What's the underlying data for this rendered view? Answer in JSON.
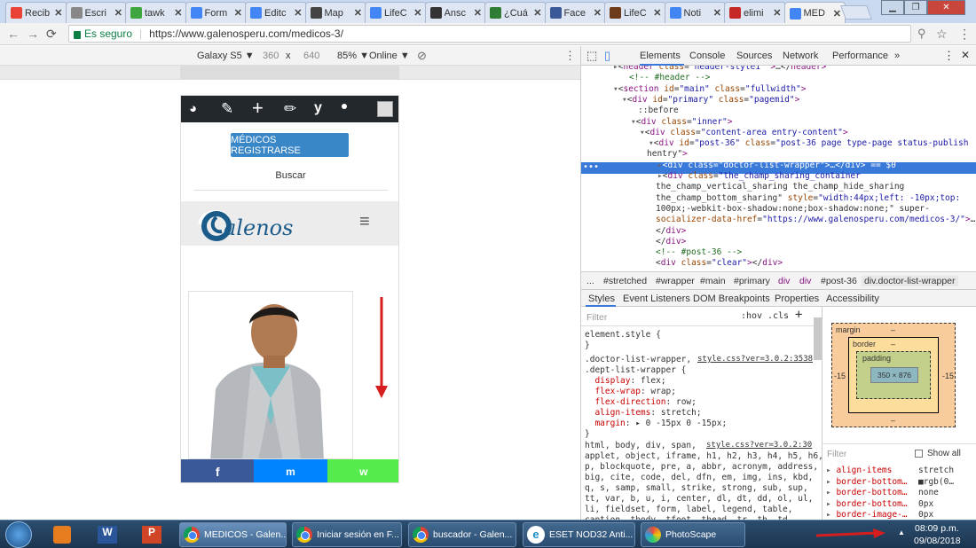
{
  "tabs": [
    {
      "label": "Recib",
      "icon": "gmail-icon"
    },
    {
      "label": "Escri",
      "icon": "document-icon"
    },
    {
      "label": "tawk",
      "icon": "tawk-icon"
    },
    {
      "label": "Form",
      "icon": "chrome-icon"
    },
    {
      "label": "Editc",
      "icon": "chrome-icon"
    },
    {
      "label": "Map",
      "icon": "map-icon"
    },
    {
      "label": "LifeC",
      "icon": "chrome-icon"
    },
    {
      "label": "Ansc",
      "icon": "grid-icon"
    },
    {
      "label": "¿Cuá",
      "icon": "sep-icon"
    },
    {
      "label": "Face",
      "icon": "facebook-icon"
    },
    {
      "label": "LifeC",
      "icon": "book-icon"
    },
    {
      "label": "Noti",
      "icon": "chrome-icon"
    },
    {
      "label": "elimi",
      "icon": "u-icon"
    },
    {
      "label": "MED",
      "icon": "chrome-icon"
    }
  ],
  "address": {
    "secure_label": "Es seguro",
    "url": "https://www.galenosperu.com/medicos-3/"
  },
  "device_toolbar": {
    "device": "Galaxy S5 ▼",
    "width": "360",
    "times": "x",
    "height": "640",
    "zoom": "85% ▼",
    "network": "Online ▼"
  },
  "phone": {
    "register_button": "MÉDICOS REGISTRARSE",
    "search_label": "Buscar",
    "logo_text": "alenos",
    "menu_glyph": "≡",
    "social": {
      "facebook": "f",
      "messenger": "m",
      "whatsapp": "w"
    }
  },
  "devtools": {
    "tabs": [
      "Elements",
      "Console",
      "Sources",
      "Network",
      "Performance",
      "»"
    ],
    "dom_lines": [
      {
        "indent": 0,
        "arrow": "▸",
        "html": "<header class=\"header-style1 \">…</header>"
      },
      {
        "indent": 1,
        "arrow": "",
        "html": "<!-- #header -->"
      },
      {
        "indent": 0,
        "arrow": "▾",
        "html": "<section id=\"main\" class=\"fullwidth\">"
      },
      {
        "indent": 1,
        "arrow": "▾",
        "html": "<div id=\"primary\" class=\"pagemid\">"
      },
      {
        "indent": 2,
        "arrow": "",
        "html": "::before"
      },
      {
        "indent": 2,
        "arrow": "▾",
        "html": "<div class=\"inner\">"
      },
      {
        "indent": 3,
        "arrow": "▾",
        "html": "<div class=\"content-area entry-content\">"
      },
      {
        "indent": 4,
        "arrow": "▾",
        "html": "<div id=\"post-36\" class=\"post-36 page type-page status-publish"
      },
      {
        "indent": 3,
        "arrow": "",
        "html": "hentry\">"
      },
      {
        "indent": 5,
        "arrow": "▸",
        "html": "<div class=\"doctor-list-wrapper\">…</div> == $0"
      },
      {
        "indent": 5,
        "arrow": "▸",
        "html": "<div class=\"the_champ_sharing_container"
      },
      {
        "indent": 4,
        "arrow": "",
        "html": "the_champ_vertical_sharing the_champ_hide_sharing"
      },
      {
        "indent": 4,
        "arrow": "",
        "html": "the_champ_bottom_sharing\" style=\"width:44px;left: -10px;top:"
      },
      {
        "indent": 4,
        "arrow": "",
        "html": "100px;-webkit-box-shadow:none;box-shadow:none;\" super-"
      },
      {
        "indent": 4,
        "arrow": "",
        "html": "socializer-data-href=\"https://www.galenosperu.com/medicos-3/\">…"
      },
      {
        "indent": 4,
        "arrow": "",
        "html": "</div>"
      },
      {
        "indent": 4,
        "arrow": "",
        "html": "</div>"
      },
      {
        "indent": 4,
        "arrow": "",
        "html": "<!-- #post-36 -->"
      },
      {
        "indent": 4,
        "arrow": "",
        "html": "<div class=\"clear\"></div>"
      }
    ],
    "breadcrumbs": [
      "...",
      "#stretched",
      "#wrapper",
      "#main",
      "#primary",
      "div",
      "div",
      "#post-36",
      "div.doctor-list-wrapper"
    ],
    "style_tabs": [
      "Styles",
      "Event Listeners",
      "DOM Breakpoints",
      "Properties",
      "Accessibility"
    ],
    "filter_placeholder": "Filter",
    "hov": ":hov",
    "cls": ".cls",
    "style_lines": [
      "element.style {",
      "}",
      ".doctor-list-wrapper,",
      ".dept-list-wrapper {",
      "  display: flex;",
      "  flex-wrap: wrap;",
      "  flex-direction: row;",
      "  align-items: stretch;",
      "  margin: ▸ 0 -15px 0 -15px;",
      "}",
      "html, body, div, span,",
      "applet, object, iframe, h1, h2, h3, h4, h5, h6,",
      "p, blockquote, pre, a, abbr, acronym, address,",
      "big, cite, code, del, dfn, em, img, ins, kbd,",
      "q, s, samp, small, strike, strong, sub, sup,",
      "tt, var, b, u, i, center, dl, dt, dd, ol, ul,",
      "li, fieldset, form, label, legend, table,",
      "caption, tbody, tfoot, thead, tr, th, td,"
    ],
    "style_link1": "style.css?ver=3.0.2:3538",
    "style_link2": "style.css?ver=3.0.2:30",
    "box_model": {
      "margin_label": "margin",
      "border_label": "border",
      "padding_label": "padding",
      "content": "350 × 876",
      "margin_left": "-15",
      "margin_right": "-15",
      "dash": "–"
    },
    "computed_filter": "Filter",
    "show_all": "Show all",
    "computed": [
      {
        "prop": "align-items",
        "val": "stretch"
      },
      {
        "prop": "border-bottom…",
        "val": "rgb(0…"
      },
      {
        "prop": "border-bottom…",
        "val": "none"
      },
      {
        "prop": "border-bottom…",
        "val": "0px"
      },
      {
        "prop": "border-image-…",
        "val": "0px"
      }
    ]
  },
  "taskbar": {
    "items": [
      {
        "label": "MEDICOS - Galen...",
        "icon": "chrome-icon"
      },
      {
        "label": "Iniciar sesión en F...",
        "icon": "chrome-icon"
      },
      {
        "label": "buscador - Galen...",
        "icon": "chrome-icon"
      },
      {
        "label": "ESET NOD32 Anti...",
        "icon": "eset-icon"
      },
      {
        "label": "PhotoScape",
        "icon": "photoscape-icon"
      }
    ],
    "time": "08:09 p.m.",
    "date": "09/08/2018"
  }
}
